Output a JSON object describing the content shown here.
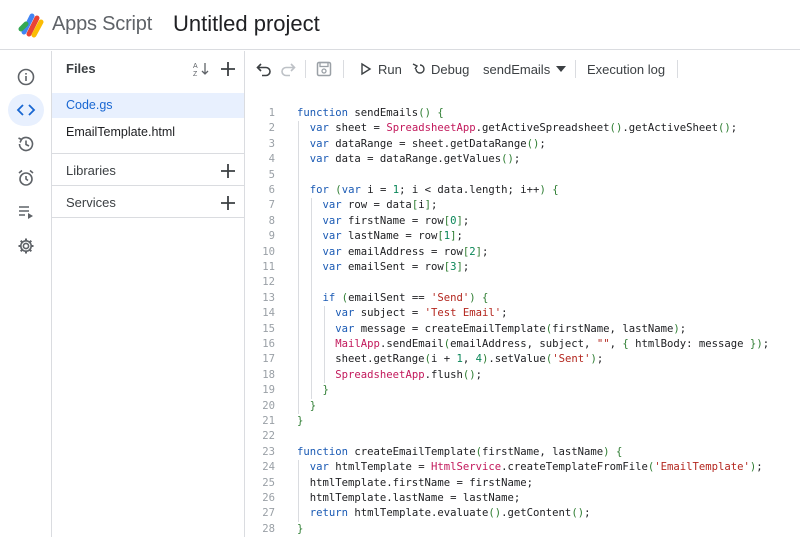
{
  "app": {
    "brand": "Apps Script",
    "project_title": "Untitled project"
  },
  "rail": {
    "items": [
      {
        "name": "overview",
        "icon": "info-icon",
        "active": false
      },
      {
        "name": "editor",
        "icon": "code-icon",
        "active": true
      },
      {
        "name": "triggers-history",
        "icon": "history-icon",
        "active": false
      },
      {
        "name": "triggers",
        "icon": "alarm-icon",
        "active": false
      },
      {
        "name": "executions",
        "icon": "executions-icon",
        "active": false
      },
      {
        "name": "settings",
        "icon": "gear-icon",
        "active": false
      }
    ]
  },
  "files_panel": {
    "title": "Files",
    "files": [
      {
        "label": "Code.gs",
        "active": true
      },
      {
        "label": "EmailTemplate.html",
        "active": false
      }
    ],
    "libraries_label": "Libraries",
    "services_label": "Services"
  },
  "toolbar": {
    "run_label": "Run",
    "debug_label": "Debug",
    "function_selected": "sendEmails",
    "execution_log_label": "Execution log"
  },
  "editor": {
    "lines": [
      "function sendEmails() {",
      "  var sheet = SpreadsheetApp.getActiveSpreadsheet().getActiveSheet();",
      "  var dataRange = sheet.getDataRange();",
      "  var data = dataRange.getValues();",
      "",
      "  for (var i = 1; i < data.length; i++) {",
      "    var row = data[i];",
      "    var firstName = row[0];",
      "    var lastName = row[1];",
      "    var emailAddress = row[2];",
      "    var emailSent = row[3];",
      "",
      "    if (emailSent == 'Send') {",
      "      var subject = 'Test Email';",
      "      var message = createEmailTemplate(firstName, lastName);",
      "      MailApp.sendEmail(emailAddress, subject, \"\", { htmlBody: message });",
      "      sheet.getRange(i + 1, 4).setValue('Sent');",
      "      SpreadsheetApp.flush();",
      "    }",
      "  }",
      "}",
      "",
      "function createEmailTemplate(firstName, lastName) {",
      "  var htmlTemplate = HtmlService.createTemplateFromFile('EmailTemplate');",
      "  htmlTemplate.firstName = firstName;",
      "  htmlTemplate.lastName = lastName;",
      "  return htmlTemplate.evaluate().getContent();",
      "}"
    ]
  },
  "colors": {
    "accent": "#1967d2",
    "active_bg": "#e8f0fe",
    "keyword": "#1a5ab4",
    "class_name": "#c2185b",
    "string": "#b3261e",
    "number": "#098658",
    "bracket": "#2e7d32"
  }
}
